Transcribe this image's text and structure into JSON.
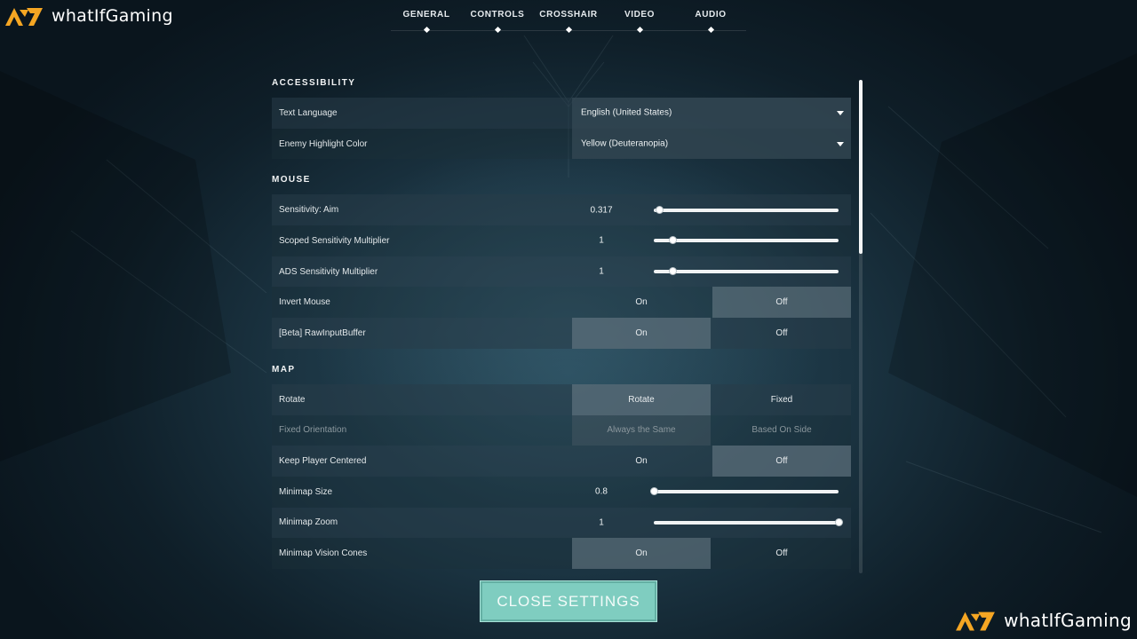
{
  "brand": {
    "logo_text": "whatIfGaming",
    "accent": "#f5a623"
  },
  "nav": {
    "tabs": [
      {
        "label": "GENERAL"
      },
      {
        "label": "CONTROLS"
      },
      {
        "label": "CROSSHAIR"
      },
      {
        "label": "VIDEO"
      },
      {
        "label": "AUDIO"
      }
    ]
  },
  "sections": {
    "accessibility": {
      "title": "ACCESSIBILITY",
      "text_language": {
        "label": "Text Language",
        "value": "English (United States)"
      },
      "enemy_highlight": {
        "label": "Enemy Highlight Color",
        "value": "Yellow (Deuteranopia)"
      }
    },
    "mouse": {
      "title": "MOUSE",
      "sens_aim": {
        "label": "Sensitivity: Aim",
        "value": "0.317",
        "fill": 0.03
      },
      "scoped_mult": {
        "label": "Scoped Sensitivity Multiplier",
        "value": "1",
        "fill": 0.1
      },
      "ads_mult": {
        "label": "ADS Sensitivity Multiplier",
        "value": "1",
        "fill": 0.1
      },
      "invert_mouse": {
        "label": "Invert Mouse",
        "on": "On",
        "off": "Off",
        "selected": "off"
      },
      "raw_input": {
        "label": "[Beta] RawInputBuffer",
        "on": "On",
        "off": "Off",
        "selected": "on"
      }
    },
    "map": {
      "title": "MAP",
      "rotate": {
        "label": "Rotate",
        "opt1": "Rotate",
        "opt2": "Fixed",
        "selected": "opt1"
      },
      "fixed_orientation": {
        "label": "Fixed Orientation",
        "opt1": "Always the Same",
        "opt2": "Based On Side",
        "selected": "opt1"
      },
      "keep_centered": {
        "label": "Keep Player Centered",
        "on": "On",
        "off": "Off",
        "selected": "off"
      },
      "minimap_size": {
        "label": "Minimap Size",
        "value": "0.8",
        "fill": 0.0
      },
      "minimap_zoom": {
        "label": "Minimap Zoom",
        "value": "1",
        "fill": 1.0
      },
      "vision_cones": {
        "label": "Minimap Vision Cones",
        "on": "On",
        "off": "Off",
        "selected": "on"
      }
    }
  },
  "scroll": {
    "fraction": 0.35
  },
  "close_button": {
    "label": "CLOSE SETTINGS"
  }
}
